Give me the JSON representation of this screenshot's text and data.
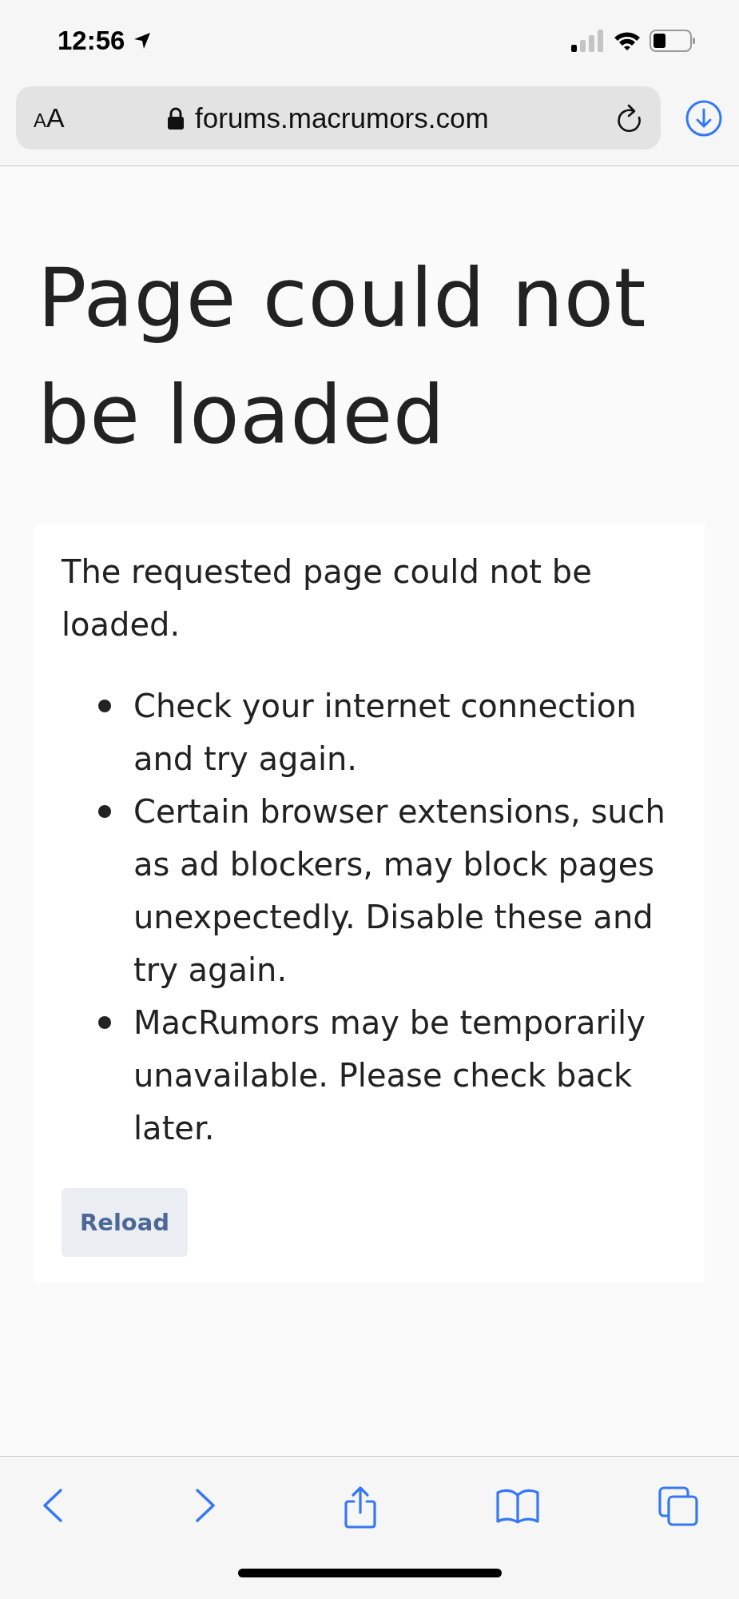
{
  "status_bar": {
    "time": "12:56",
    "location_active": true
  },
  "address_bar": {
    "text_size_button": "AA",
    "secure": true,
    "url": "forums.macrumors.com"
  },
  "page": {
    "heading": "Page could not be loaded",
    "card": {
      "intro": "The requested page could not be loaded.",
      "bullets": [
        "Check your internet connection and try again.",
        "Certain browser extensions, such as ad blockers, may block pages unexpectedly. Disable these and try again.",
        "MacRumors may be temporarily unavailable. Please check back later."
      ],
      "button": "Reload"
    }
  },
  "toolbar": {
    "back_disabled": false,
    "forward_disabled": false
  }
}
